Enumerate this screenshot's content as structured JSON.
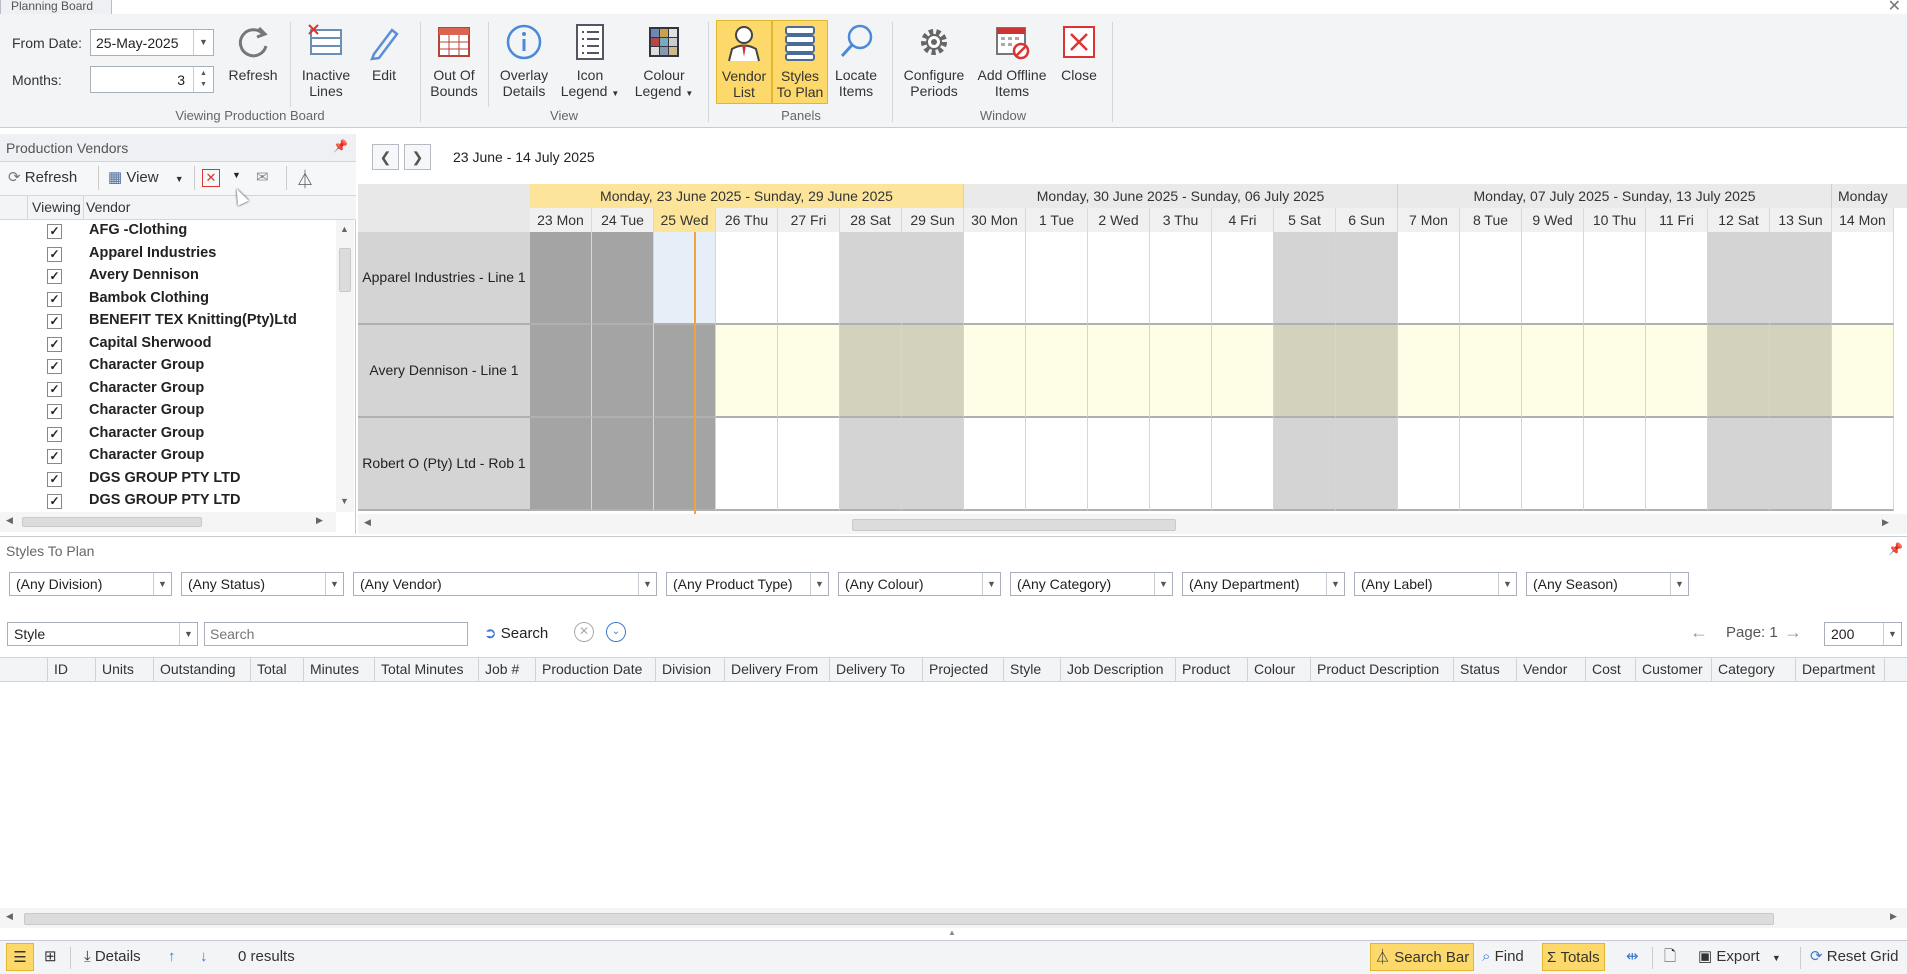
{
  "window": {
    "tab_title": "Planning Board"
  },
  "ribbon": {
    "from_date_label": "From Date:",
    "from_date_value": "25-May-2025",
    "months_label": "Months:",
    "months_value": "3",
    "refresh": "Refresh",
    "inactive_lines_1": "Inactive",
    "inactive_lines_2": "Lines",
    "edit": "Edit",
    "group_viewing": "Viewing Production Board",
    "out_of_bounds_1": "Out Of",
    "out_of_bounds_2": "Bounds",
    "overlay_details_1": "Overlay",
    "overlay_details_2": "Details",
    "icon_legend_1": "Icon",
    "icon_legend_2": "Legend",
    "colour_legend_1": "Colour",
    "colour_legend_2": "Legend",
    "group_view": "View",
    "vendor_list_1": "Vendor",
    "vendor_list_2": "List",
    "styles_to_plan_1": "Styles",
    "styles_to_plan_2": "To Plan",
    "locate_items_1": "Locate",
    "locate_items_2": "Items",
    "group_panels": "Panels",
    "configure_periods_1": "Configure",
    "configure_periods_2": "Periods",
    "add_offline_1": "Add Offline",
    "add_offline_2": "Items",
    "close": "Close",
    "group_window": "Window"
  },
  "vendors_panel": {
    "title": "Production Vendors",
    "refresh": "Refresh",
    "view": "View",
    "col_viewing": "Viewing",
    "col_vendor": "Vendor",
    "items": [
      {
        "name": "AFG -Clothing",
        "checked": true
      },
      {
        "name": "Apparel Industries",
        "checked": true
      },
      {
        "name": "Avery Dennison",
        "checked": true
      },
      {
        "name": "Bambok Clothing",
        "checked": true
      },
      {
        "name": "BENEFIT TEX Knitting(Pty)Ltd",
        "checked": true
      },
      {
        "name": "Capital Sherwood",
        "checked": true
      },
      {
        "name": "Character Group",
        "checked": true
      },
      {
        "name": "Character Group",
        "checked": true
      },
      {
        "name": "Character Group",
        "checked": true
      },
      {
        "name": "Character Group",
        "checked": true
      },
      {
        "name": "Character Group",
        "checked": true
      },
      {
        "name": "DGS GROUP PTY LTD",
        "checked": true
      },
      {
        "name": "DGS GROUP PTY LTD",
        "checked": true
      }
    ]
  },
  "board": {
    "range": "23 June - 14 July 2025",
    "weeks": [
      {
        "label": "Monday, 23 June 2025 - Sunday, 29 June 2025",
        "current": true
      },
      {
        "label": "Monday, 30 June 2025 - Sunday, 06 July 2025",
        "current": false
      },
      {
        "label": "Monday, 07 July 2025 - Sunday, 13 July 2025",
        "current": false
      },
      {
        "label": "Monday",
        "current": false
      }
    ],
    "days": [
      "23 Mon",
      "24 Tue",
      "25 Wed",
      "26 Thu",
      "27 Fri",
      "28 Sat",
      "29 Sun",
      "30 Mon",
      "1 Tue",
      "2 Wed",
      "3 Thu",
      "4 Fri",
      "5 Sat",
      "6 Sun",
      "7 Mon",
      "8 Tue",
      "9 Wed",
      "10 Thu",
      "11 Fri",
      "12 Sat",
      "13 Sun",
      "14 Mon"
    ],
    "rows": [
      "Apparel Industries - Line 1",
      "Avery Dennison - Line 1",
      "Robert O (Pty) Ltd - Rob 1"
    ]
  },
  "styles_panel": {
    "title": "Styles To Plan",
    "filters": [
      "(Any Division)",
      "(Any Status)",
      "(Any Vendor)",
      "(Any Product Type)",
      "(Any Colour)",
      "(Any Category)",
      "(Any Department)",
      "(Any Label)",
      "(Any Season)"
    ],
    "search_field": "Style",
    "search_placeholder": "Search",
    "search_btn": "Search",
    "page_label": "Page: 1",
    "page_size": "200",
    "columns": [
      "ID",
      "Units",
      "Outstanding",
      "Total",
      "Minutes",
      "Total Minutes",
      "Job #",
      "Production Date",
      "Division",
      "Delivery From",
      "Delivery To",
      "Projected",
      "Style",
      "Job Description",
      "Product",
      "Colour",
      "Product Description",
      "Status",
      "Vendor",
      "Cost",
      "Customer",
      "Category",
      "Department"
    ]
  },
  "statusbar": {
    "details": "Details",
    "results": "0 results",
    "search_bar": "Search Bar",
    "find": "Find",
    "totals": "Totals",
    "export": "Export",
    "reset_grid": "Reset Grid"
  }
}
